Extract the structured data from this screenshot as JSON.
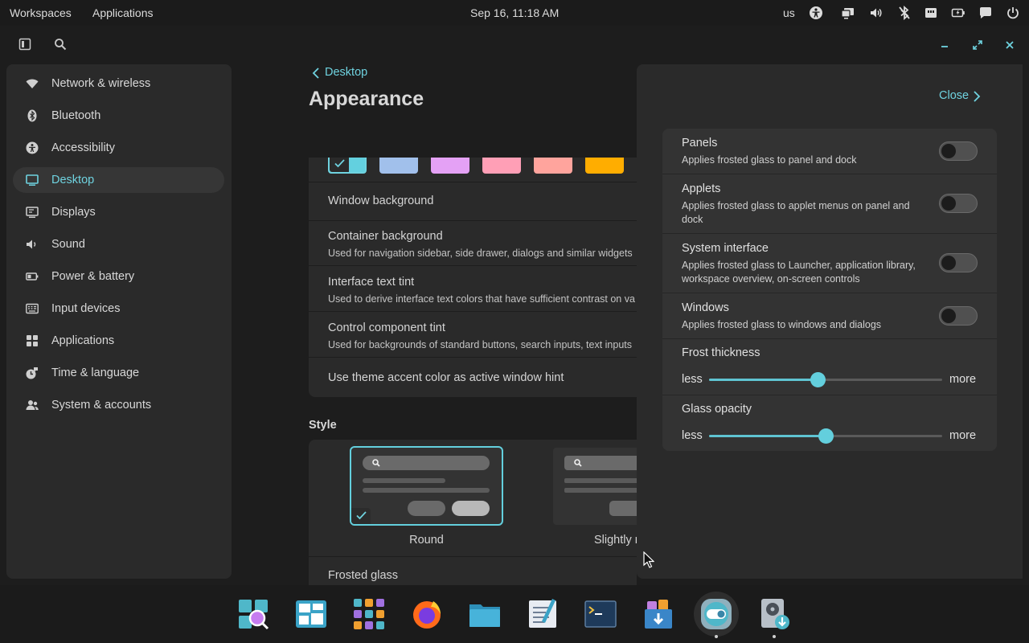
{
  "topbar": {
    "workspaces": "Workspaces",
    "applications": "Applications",
    "clock": "Sep 16, 11:18 AM",
    "keyboard_layout": "us",
    "tray_icons": [
      "accessibility-icon",
      "display-icon",
      "volume-icon",
      "bluetooth-off-icon",
      "network-icon",
      "battery-icon",
      "notifications-icon",
      "power-icon"
    ]
  },
  "window": {
    "header_icons": [
      "sidebar-toggle-icon",
      "search-icon",
      "minimize-icon",
      "maximize-icon",
      "close-icon"
    ]
  },
  "sidebar": {
    "items": [
      {
        "label": "Network & wireless",
        "icon": "wifi-icon"
      },
      {
        "label": "Bluetooth",
        "icon": "bluetooth-icon"
      },
      {
        "label": "Accessibility",
        "icon": "accessibility-icon"
      },
      {
        "label": "Desktop",
        "icon": "desktop-icon",
        "active": true
      },
      {
        "label": "Displays",
        "icon": "displays-icon"
      },
      {
        "label": "Sound",
        "icon": "sound-icon"
      },
      {
        "label": "Power & battery",
        "icon": "battery-icon"
      },
      {
        "label": "Input devices",
        "icon": "keyboard-icon"
      },
      {
        "label": "Applications",
        "icon": "apps-grid-icon"
      },
      {
        "label": "Time & language",
        "icon": "time-language-icon"
      },
      {
        "label": "System & accounts",
        "icon": "accounts-icon"
      }
    ]
  },
  "page": {
    "back_label": "Desktop",
    "title": "Appearance",
    "accent_swatches": [
      "#63d0df",
      "#a1c0eb",
      "#e4a1f5",
      "#ff9fb6",
      "#ffa49d",
      "#ffad00"
    ],
    "color_rows": [
      {
        "title": "Window background",
        "subtitle": ""
      },
      {
        "title": "Container background",
        "subtitle": "Used for navigation sidebar, side drawer, dialogs and similar widgets"
      },
      {
        "title": "Interface text tint",
        "subtitle": "Used to derive interface text colors that have sufficient contrast on va"
      },
      {
        "title": "Control component tint",
        "subtitle": "Used for backgrounds of standard buttons, search inputs, text inputs"
      },
      {
        "title": "Use theme accent color as active window hint",
        "subtitle": ""
      }
    ],
    "style_heading": "Style",
    "style_options": [
      {
        "label": "Round",
        "selected": true
      },
      {
        "label": "Slightly r",
        "selected": false
      }
    ],
    "frosted_glass_row": "Frosted glass"
  },
  "drawer": {
    "close_label": "Close",
    "toggles": [
      {
        "title": "Panels",
        "subtitle": "Applies frosted glass to panel and dock",
        "on": false
      },
      {
        "title": "Applets",
        "subtitle": "Applies frosted glass to applet menus on panel and dock",
        "on": false
      },
      {
        "title": "System interface",
        "subtitle": "Applies frosted glass to Launcher, application library, workspace overview, on-screen controls",
        "on": false
      },
      {
        "title": "Windows",
        "subtitle": "Applies frosted glass to windows and dialogs",
        "on": false
      }
    ],
    "sliders": [
      {
        "title": "Frost thickness",
        "min_label": "less",
        "max_label": "more",
        "value": 0.465
      },
      {
        "title": "Glass opacity",
        "min_label": "less",
        "max_label": "more",
        "value": 0.5
      }
    ]
  },
  "dock": {
    "apps": [
      {
        "name": "launcher",
        "icon": "launcher-icon"
      },
      {
        "name": "workspaces",
        "icon": "workspaces-icon"
      },
      {
        "name": "app-library",
        "icon": "app-library-icon"
      },
      {
        "name": "firefox",
        "icon": "firefox-icon"
      },
      {
        "name": "files",
        "icon": "folder-icon"
      },
      {
        "name": "text-editor",
        "icon": "text-editor-icon"
      },
      {
        "name": "terminal",
        "icon": "terminal-icon"
      },
      {
        "name": "store",
        "icon": "store-icon"
      },
      {
        "name": "settings",
        "icon": "settings-icon",
        "active": true,
        "running": true
      },
      {
        "name": "installer",
        "icon": "installer-icon",
        "running": true
      }
    ]
  },
  "colors": {
    "accent": "#63cfdd",
    "panel": "#1b1b1b",
    "surface": "#2a2a2a",
    "card": "#333333"
  }
}
